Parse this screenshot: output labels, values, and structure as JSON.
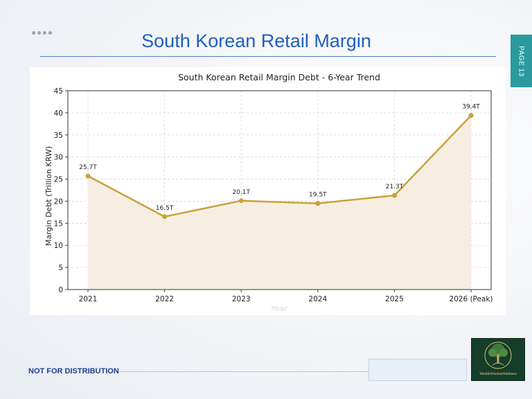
{
  "slide": {
    "title": "South Korean Retail Margin",
    "page_tab": "PAGE 13",
    "footer": "NOT FOR DISTRIBUTION",
    "logo_text": "WealthWisdomWellness",
    "colors": {
      "title": "#1f5fbf",
      "tab": "#2a9a9f",
      "footer_text": "#1f3f8f",
      "logo_bg": "#153d2a"
    }
  },
  "chart_data": {
    "type": "line",
    "title": "South Korean Retail Margin Debt - 6-Year Trend",
    "xlabel": "Year",
    "ylabel": "Margin Debt (Trillion KRW)",
    "categories": [
      "2021",
      "2022",
      "2023",
      "2024",
      "2025",
      "2026 (Peak)"
    ],
    "series": [
      {
        "values": [
          25.7,
          16.5,
          20.1,
          19.5,
          21.3,
          39.4
        ],
        "labels": [
          "25.7T",
          "16.5T",
          "20.1T",
          "19.5T",
          "21.3T",
          "39.4T"
        ],
        "color": "#c9a13b",
        "fill": "#f5ecdc"
      }
    ],
    "ylim": [
      0,
      45
    ],
    "yticks": [
      0,
      5,
      10,
      15,
      20,
      25,
      30,
      35,
      40,
      45
    ],
    "grid": true,
    "area_fill": true
  }
}
